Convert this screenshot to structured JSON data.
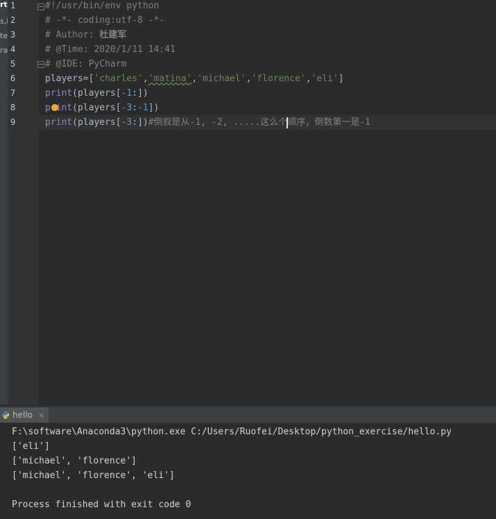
{
  "sidebar_fragments": [
    "rtl",
    "s,h",
    "te",
    "ra"
  ],
  "editor": {
    "line_numbers": [
      "1",
      "2",
      "3",
      "4",
      "5",
      "6",
      "7",
      "8",
      "9"
    ],
    "lines": [
      {
        "text": "#!/usr/bin/env python"
      },
      {
        "text": "# -*- coding:utf-8 -*-"
      },
      {
        "prefix": "# Author: ",
        "cjk": "杜建军"
      },
      {
        "text": "# @Time: 2020/1/11 14:41"
      },
      {
        "text": "# @IDE: PyCharm"
      },
      {
        "var": "players",
        "eq": "=",
        "open": "[",
        "strings": [
          "'charles'",
          "'matina'",
          "'michael'",
          "'florence'",
          "'eli'"
        ],
        "comma": ",",
        "close": "]"
      },
      {
        "fn": "print",
        "p1": "(players[",
        "n1": "-1",
        "colon": ":",
        "p2": "])"
      },
      {
        "fn": "print",
        "p1": "(players[",
        "n1": "-3",
        "colon": ":",
        "n2": "-1",
        "p2": "])"
      },
      {
        "fn": "print",
        "p1": "(players[",
        "n1": "-3",
        "colon": ":",
        "p2": "])",
        "comment_a": "#倒叙是从-1, -2, .....这么个",
        "comment_b": "顺序，倒数第一是-1"
      }
    ]
  },
  "run_tab": {
    "label": "hello",
    "close": "×"
  },
  "console": {
    "lines": [
      "F:\\software\\Anaconda3\\python.exe C:/Users/Ruofei/Desktop/python_exercise/hello.py",
      "['eli']",
      "['michael', 'florence']",
      "['michael', 'florence', 'eli']",
      "",
      "Process finished with exit code 0"
    ]
  },
  "colors": {
    "comment": "#808080",
    "builtin": "#8888c6",
    "string": "#6a8759",
    "number": "#6897bb",
    "text": "#a9b7c6"
  }
}
